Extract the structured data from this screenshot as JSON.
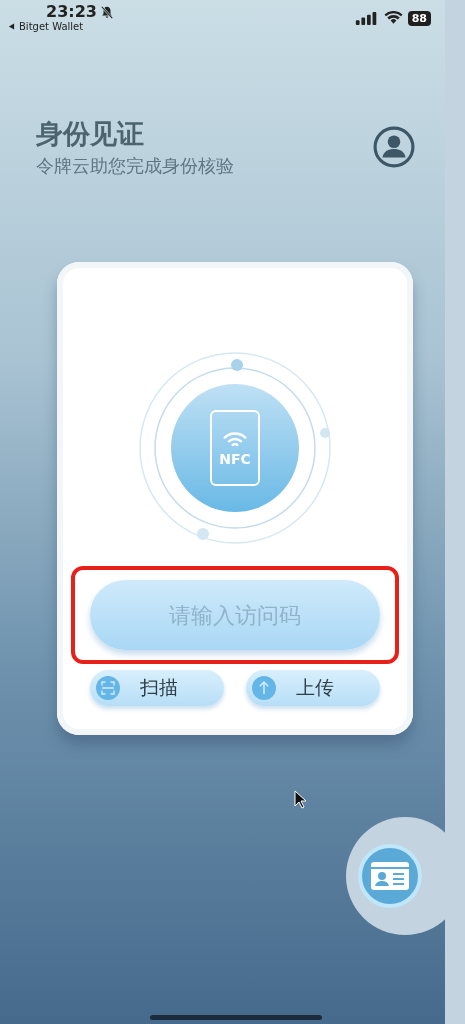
{
  "status_bar": {
    "time": "23:23",
    "muted": true,
    "back_app": "Bitget Wallet",
    "battery": "88"
  },
  "header": {
    "title": "身份见证",
    "subtitle": "令牌云助您完成身份核验"
  },
  "card": {
    "nfc_label": "NFC",
    "access_code": {
      "placeholder": "请输入访问码"
    },
    "buttons": [
      {
        "kind": "scan",
        "label": "扫描"
      },
      {
        "kind": "upload",
        "label": "上传"
      }
    ]
  }
}
